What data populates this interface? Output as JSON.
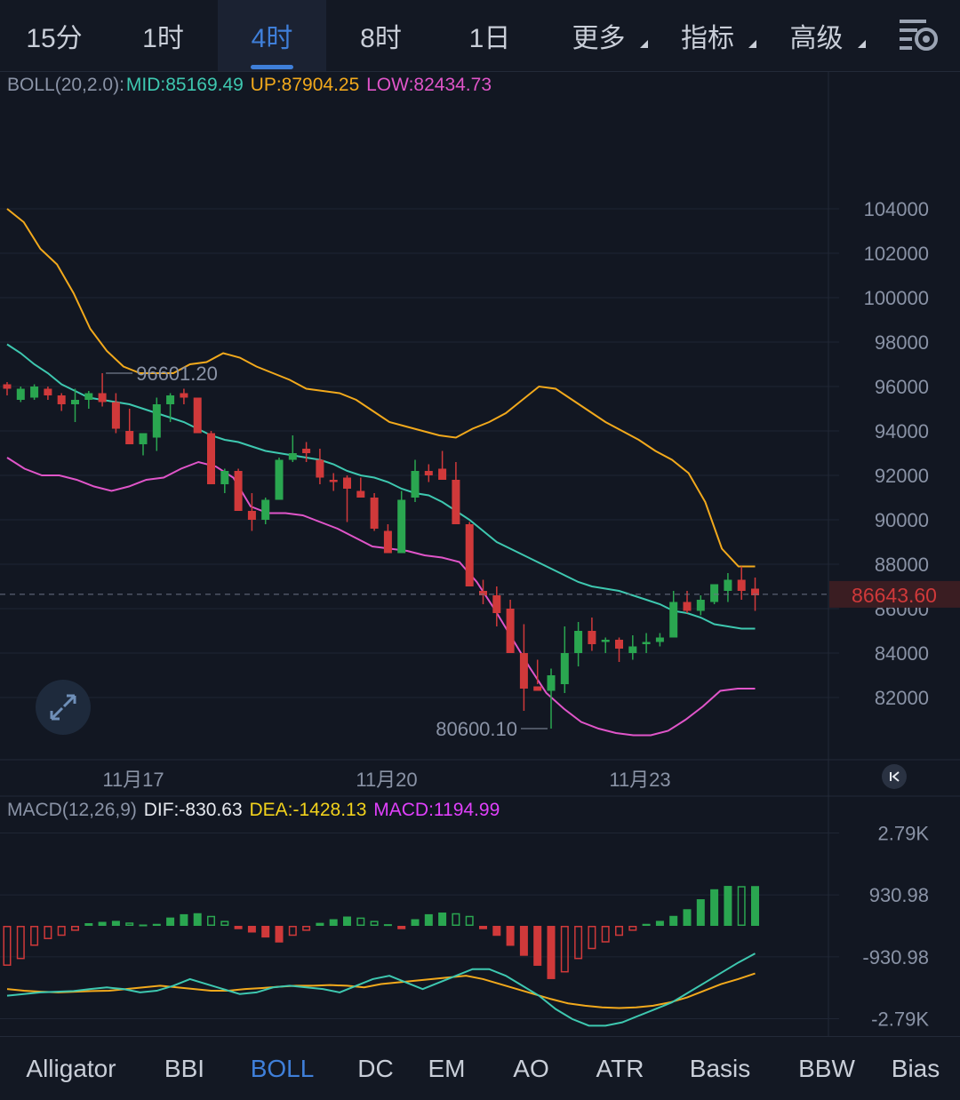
{
  "timeframes": [
    {
      "label": "15分",
      "active": false,
      "dropdown": false
    },
    {
      "label": "1时",
      "active": false,
      "dropdown": false
    },
    {
      "label": "4时",
      "active": true,
      "dropdown": false
    },
    {
      "label": "8时",
      "active": false,
      "dropdown": false
    },
    {
      "label": "1日",
      "active": false,
      "dropdown": false
    },
    {
      "label": "更多",
      "active": false,
      "dropdown": true
    },
    {
      "label": "指标",
      "active": false,
      "dropdown": true
    },
    {
      "label": "高级",
      "active": false,
      "dropdown": true
    }
  ],
  "settings_icon": "chart-settings-icon",
  "boll_legend": {
    "name": "BOLL(20,2.0):",
    "mid": "MID:85169.49",
    "up": "UP:87904.25",
    "low": "LOW:82434.73"
  },
  "macd_legend": {
    "name": "MACD(12,26,9)",
    "dif": "DIF:-830.63",
    "dea": "DEA:-1428.13",
    "macd": "MACD:1194.99"
  },
  "colors": {
    "up": "#2aa650",
    "down": "#d0393a",
    "mid": "#3ec8b0",
    "upper": "#f2a91c",
    "lower": "#e055c9",
    "dif": "#3ec8b0",
    "dea": "#f2a91c",
    "macd_label": "#e040fb",
    "price_tag": "#d0393a",
    "active": "#3f7fd9"
  },
  "bottom_indicators": [
    {
      "label": "Alligator",
      "active": false
    },
    {
      "label": "BBI",
      "active": false
    },
    {
      "label": "BOLL",
      "active": true
    },
    {
      "label": "DC",
      "active": false
    },
    {
      "label": "EM",
      "active": false
    },
    {
      "label": "AO",
      "active": false
    },
    {
      "label": "ATR",
      "active": false
    },
    {
      "label": "Basis",
      "active": false
    },
    {
      "label": "BBW",
      "active": false
    },
    {
      "label": "Bias",
      "active": false
    }
  ],
  "chart_data": [
    {
      "type": "candlestick",
      "title": "",
      "ylim": [
        80000,
        106000
      ],
      "y_ticks": [
        104000,
        102000,
        100000,
        98000,
        96000,
        94000,
        92000,
        90000,
        88000,
        86000,
        84000,
        82000
      ],
      "y_tick_labels": [
        "104000",
        "102000",
        "100000",
        "98000",
        "96000",
        "94000",
        "92000",
        "90000",
        "88000",
        "86000",
        "84000",
        "82000"
      ],
      "x_labels": [
        "11月17",
        "11月20",
        "11月23"
      ],
      "last_price": 86643.6,
      "last_price_label": "86643.60",
      "high_annotation": {
        "value": 96601.2,
        "label": "96601.20"
      },
      "low_annotation": {
        "value": 80600.1,
        "label": "80600.10"
      },
      "candles": [
        [
          96100,
          96200,
          95600,
          95900
        ],
        [
          95400,
          96000,
          95300,
          95900
        ],
        [
          95500,
          96100,
          95400,
          96000
        ],
        [
          95900,
          96000,
          95400,
          95600
        ],
        [
          95600,
          95700,
          94900,
          95200
        ],
        [
          95200,
          95900,
          94400,
          95400
        ],
        [
          95400,
          95800,
          95000,
          95700
        ],
        [
          95700,
          96600,
          95100,
          95300
        ],
        [
          95300,
          95700,
          93900,
          94100
        ],
        [
          94000,
          95000,
          93500,
          93400
        ],
        [
          93400,
          93900,
          92900,
          93900
        ],
        [
          93700,
          95500,
          93100,
          95200
        ],
        [
          95200,
          95700,
          94400,
          95600
        ],
        [
          95700,
          95900,
          95200,
          95500
        ],
        [
          95500,
          95500,
          93900,
          93900
        ],
        [
          93900,
          94000,
          91600,
          91600
        ],
        [
          91600,
          92300,
          91200,
          92200
        ],
        [
          92200,
          92300,
          90500,
          90400
        ],
        [
          90400,
          91200,
          89500,
          90000
        ],
        [
          90000,
          91000,
          89800,
          90900
        ],
        [
          90900,
          92800,
          90900,
          92700
        ],
        [
          92700,
          93800,
          92600,
          93000
        ],
        [
          93200,
          93500,
          92600,
          93000
        ],
        [
          92700,
          93200,
          91600,
          91900
        ],
        [
          91800,
          92100,
          91300,
          91700
        ],
        [
          91900,
          92000,
          89900,
          91400
        ],
        [
          91300,
          91900,
          91000,
          91000
        ],
        [
          91000,
          91200,
          89500,
          89600
        ],
        [
          89500,
          89800,
          88600,
          88500
        ],
        [
          88500,
          91300,
          88500,
          90900
        ],
        [
          91000,
          92700,
          90800,
          92200
        ],
        [
          92200,
          92500,
          91700,
          92000
        ],
        [
          92300,
          93100,
          92100,
          91800
        ],
        [
          91800,
          92600,
          91700,
          89800
        ],
        [
          89800,
          89900,
          89600,
          87000
        ],
        [
          86800,
          87300,
          86200,
          86600
        ],
        [
          86600,
          87000,
          85200,
          85800
        ],
        [
          86000,
          86400,
          84000,
          84000
        ],
        [
          84000,
          85300,
          81400,
          82400
        ],
        [
          82500,
          83700,
          82600,
          82300
        ],
        [
          82300,
          83300,
          80600,
          83000
        ],
        [
          82600,
          85200,
          82200,
          84000
        ],
        [
          84000,
          85400,
          83400,
          85000
        ],
        [
          85000,
          85600,
          84100,
          84400
        ],
        [
          84500,
          84700,
          84000,
          84600
        ],
        [
          84600,
          84700,
          83600,
          84200
        ],
        [
          84000,
          84800,
          83700,
          84300
        ],
        [
          84400,
          84900,
          84000,
          84500
        ],
        [
          84500,
          84900,
          84300,
          84700
        ],
        [
          84700,
          86800,
          84700,
          86300
        ],
        [
          86300,
          86800,
          85800,
          85900
        ],
        [
          85900,
          86600,
          85700,
          86400
        ],
        [
          86300,
          87100,
          86200,
          87100
        ],
        [
          86800,
          87600,
          86300,
          87300
        ],
        [
          87300,
          87900,
          86400,
          86800
        ],
        [
          86900,
          87400,
          85900,
          86600
        ]
      ],
      "boll_mid": [
        97900,
        97500,
        97000,
        96600,
        96100,
        95800,
        95500,
        95400,
        95300,
        95200,
        95000,
        94800,
        94600,
        94400,
        94100,
        93800,
        93600,
        93500,
        93300,
        93100,
        93000,
        92900,
        92800,
        92700,
        92500,
        92200,
        92000,
        91900,
        91700,
        91400,
        91200,
        91100,
        90800,
        90400,
        90000,
        89500,
        89000,
        88700,
        88400,
        88100,
        87800,
        87500,
        87200,
        87000,
        86900,
        86800,
        86600,
        86400,
        86200,
        85900,
        85800,
        85600,
        85300,
        85200,
        85100,
        85100
      ],
      "boll_up": [
        104000,
        103400,
        102200,
        101500,
        100200,
        98600,
        97600,
        96900,
        96600,
        96600,
        96600,
        97000,
        97100,
        97500,
        97300,
        96900,
        96600,
        96300,
        95900,
        95800,
        95700,
        95400,
        94900,
        94400,
        94200,
        94000,
        93800,
        93700,
        94100,
        94400,
        94800,
        95400,
        96000,
        95900,
        95400,
        94900,
        94400,
        94000,
        93600,
        93100,
        92700,
        92100,
        90800,
        88700,
        87900,
        87900
      ],
      "boll_low": [
        92800,
        92300,
        92000,
        92000,
        91800,
        91500,
        91300,
        91500,
        91800,
        91900,
        92300,
        92600,
        92400,
        91900,
        90600,
        90300,
        90300,
        90200,
        89900,
        89600,
        89200,
        88800,
        88700,
        88600,
        88400,
        88300,
        88100,
        87200,
        86000,
        84700,
        83400,
        82200,
        81500,
        80900,
        80600,
        80400,
        80300,
        80300,
        80500,
        81000,
        81600,
        82300,
        82400,
        82400
      ],
      "boll_up_start": 10,
      "boll_low_start": 12
    },
    {
      "type": "bar+line",
      "title": "",
      "ylim": [
        -3500,
        3500
      ],
      "y_ticks": [
        2790,
        930.98,
        -930.98,
        -2790
      ],
      "y_tick_labels": [
        "2.79K",
        "930.98",
        "-930.98",
        "-2.79K"
      ],
      "histogram": [
        -1200,
        -1000,
        -600,
        -400,
        -300,
        -150,
        80,
        120,
        150,
        100,
        40,
        60,
        250,
        350,
        380,
        300,
        150,
        -100,
        -200,
        -350,
        -500,
        -300,
        -150,
        90,
        200,
        280,
        250,
        150,
        50,
        -100,
        200,
        350,
        400,
        380,
        300,
        -100,
        -300,
        -600,
        -900,
        -1200,
        -1600,
        -1400,
        -1000,
        -700,
        -500,
        -300,
        -150,
        60,
        150,
        300,
        500,
        800,
        1100,
        1200,
        1195,
        1195
      ],
      "dif": [
        -2100,
        -2050,
        -2000,
        -1980,
        -1960,
        -1900,
        -1850,
        -1900,
        -2000,
        -1950,
        -1800,
        -1600,
        -1750,
        -1900,
        -2050,
        -2000,
        -1850,
        -1800,
        -1850,
        -1900,
        -2000,
        -1800,
        -1600,
        -1500,
        -1700,
        -1900,
        -1700,
        -1500,
        -1300,
        -1300,
        -1500,
        -1800,
        -2100,
        -2500,
        -2800,
        -3000,
        -3000,
        -2900,
        -2700,
        -2500,
        -2300,
        -2000,
        -1700,
        -1400,
        -1100,
        -830
      ],
      "dea": [
        -1900,
        -1950,
        -1980,
        -2000,
        -1980,
        -1960,
        -1950,
        -1900,
        -1850,
        -1800,
        -1850,
        -1900,
        -1950,
        -1950,
        -1900,
        -1870,
        -1830,
        -1800,
        -1800,
        -1780,
        -1800,
        -1850,
        -1750,
        -1700,
        -1650,
        -1600,
        -1550,
        -1500,
        -1600,
        -1750,
        -1900,
        -2050,
        -2200,
        -2330,
        -2400,
        -2450,
        -2470,
        -2450,
        -2400,
        -2300,
        -2150,
        -1950,
        -1750,
        -1600,
        -1430
      ],
      "dif_start": 10,
      "dea_start": 11
    }
  ]
}
